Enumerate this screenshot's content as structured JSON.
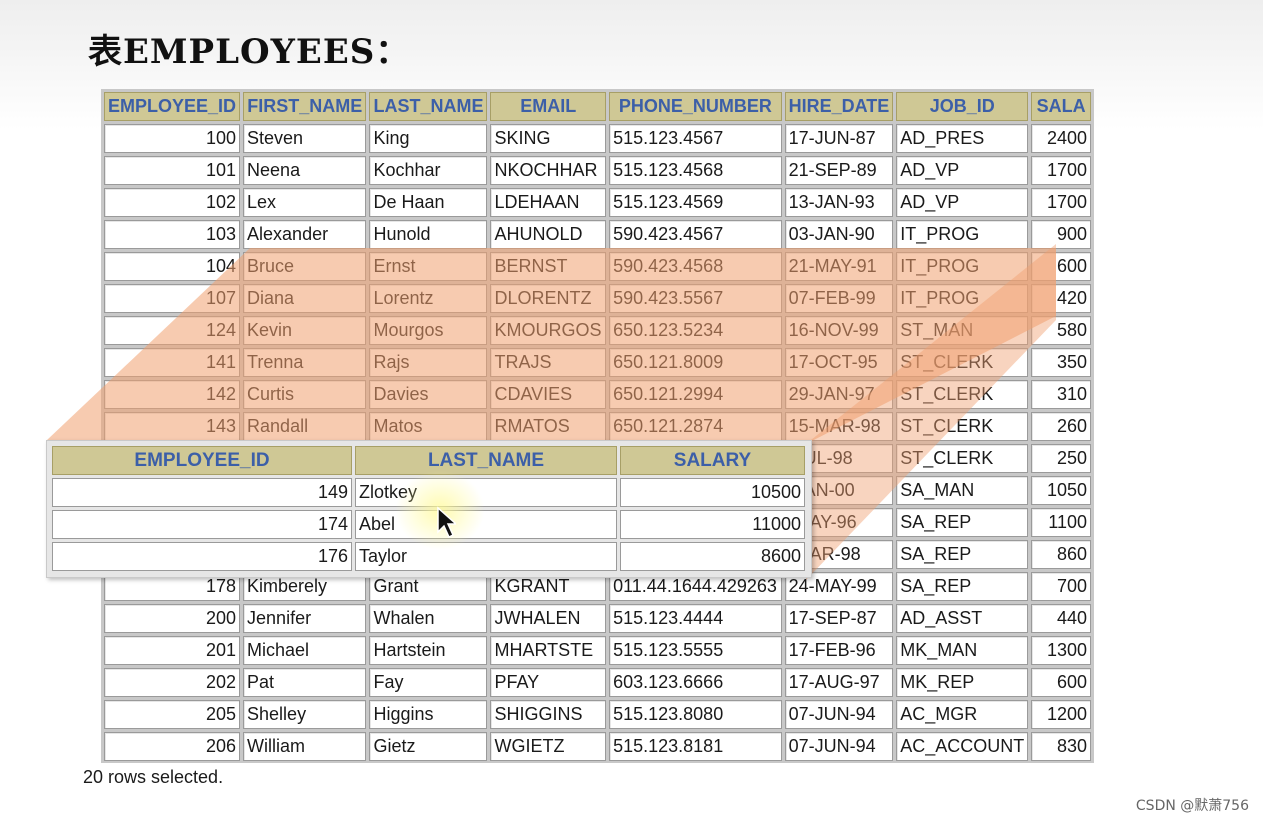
{
  "title": "表EMPLOYEES：",
  "main_table": {
    "headers": [
      "EMPLOYEE_ID",
      "FIRST_NAME",
      "LAST_NAME",
      "EMAIL",
      "PHONE_NUMBER",
      "HIRE_DATE",
      "JOB_ID",
      "SALA"
    ],
    "rows": [
      [
        "100",
        "Steven",
        "King",
        "SKING",
        "515.123.4567",
        "17-JUN-87",
        "AD_PRES",
        "2400"
      ],
      [
        "101",
        "Neena",
        "Kochhar",
        "NKOCHHAR",
        "515.123.4568",
        "21-SEP-89",
        "AD_VP",
        "1700"
      ],
      [
        "102",
        "Lex",
        "De Haan",
        "LDEHAAN",
        "515.123.4569",
        "13-JAN-93",
        "AD_VP",
        "1700"
      ],
      [
        "103",
        "Alexander",
        "Hunold",
        "AHUNOLD",
        "590.423.4567",
        "03-JAN-90",
        "IT_PROG",
        "900"
      ],
      [
        "104",
        "Bruce",
        "Ernst",
        "BERNST",
        "590.423.4568",
        "21-MAY-91",
        "IT_PROG",
        "600"
      ],
      [
        "107",
        "Diana",
        "Lorentz",
        "DLORENTZ",
        "590.423.5567",
        "07-FEB-99",
        "IT_PROG",
        "420"
      ],
      [
        "124",
        "Kevin",
        "Mourgos",
        "KMOURGOS",
        "650.123.5234",
        "16-NOV-99",
        "ST_MAN",
        "580"
      ],
      [
        "141",
        "Trenna",
        "Rajs",
        "TRAJS",
        "650.121.8009",
        "17-OCT-95",
        "ST_CLERK",
        "350"
      ],
      [
        "142",
        "Curtis",
        "Davies",
        "CDAVIES",
        "650.121.2994",
        "29-JAN-97",
        "ST_CLERK",
        "310"
      ],
      [
        "143",
        "Randall",
        "Matos",
        "RMATOS",
        "650.121.2874",
        "15-MAR-98",
        "ST_CLERK",
        "260"
      ],
      [
        "",
        "",
        "",
        "",
        "",
        "-JUL-98",
        "ST_CLERK",
        "250"
      ],
      [
        "",
        "",
        "",
        "",
        "",
        "-JAN-00",
        "SA_MAN",
        "1050"
      ],
      [
        "",
        "",
        "",
        "",
        "",
        "-MAY-96",
        "SA_REP",
        "1100"
      ],
      [
        "",
        "",
        "",
        "",
        "",
        "-MAR-98",
        "SA_REP",
        "860"
      ],
      [
        "178",
        "Kimberely",
        "Grant",
        "KGRANT",
        "011.44.1644.429263",
        "24-MAY-99",
        "SA_REP",
        "700"
      ],
      [
        "200",
        "Jennifer",
        "Whalen",
        "JWHALEN",
        "515.123.4444",
        "17-SEP-87",
        "AD_ASST",
        "440"
      ],
      [
        "201",
        "Michael",
        "Hartstein",
        "MHARTSTE",
        "515.123.5555",
        "17-FEB-96",
        "MK_MAN",
        "1300"
      ],
      [
        "202",
        "Pat",
        "Fay",
        "PFAY",
        "603.123.6666",
        "17-AUG-97",
        "MK_REP",
        "600"
      ],
      [
        "205",
        "Shelley",
        "Higgins",
        "SHIGGINS",
        "515.123.8080",
        "07-JUN-94",
        "AC_MGR",
        "1200"
      ],
      [
        "206",
        "William",
        "Gietz",
        "WGIETZ",
        "515.123.8181",
        "07-JUN-94",
        "AC_ACCOUNT",
        "830"
      ]
    ]
  },
  "sub_table": {
    "headers": [
      "EMPLOYEE_ID",
      "LAST_NAME",
      "SALARY"
    ],
    "rows": [
      [
        "149",
        "Zlotkey",
        "10500"
      ],
      [
        "174",
        "Abel",
        "11000"
      ],
      [
        "176",
        "Taylor",
        "8600"
      ]
    ]
  },
  "footer": "20 rows selected.",
  "watermark": "CSDN @默萧756",
  "colors": {
    "header_bg": "#cfc895",
    "header_text": "#3c5fa8",
    "overlay": "#f0a070"
  },
  "icons": [
    "mouse-pointer-icon"
  ]
}
